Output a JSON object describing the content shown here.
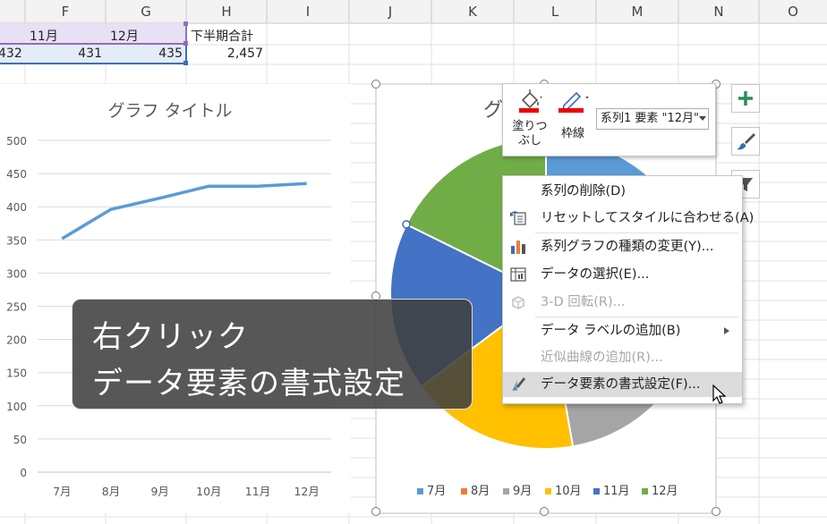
{
  "columns": [
    "F",
    "G",
    "H",
    "I",
    "J",
    "K",
    "L",
    "M",
    "N",
    "O"
  ],
  "sheet": {
    "header_row": {
      "f": "11月",
      "g": "12月",
      "h": "下半期合計"
    },
    "data_row": {
      "e_partial": "432",
      "f": "431",
      "g": "435",
      "h": "2,457"
    }
  },
  "line_chart": {
    "chart_data": {
      "type": "line",
      "title": "グラフ タイトル",
      "categories": [
        "7月",
        "8月",
        "9月",
        "10月",
        "11月",
        "12月"
      ],
      "values": [
        352,
        396,
        413,
        431,
        431,
        435
      ],
      "y_ticks": [
        "0",
        "50",
        "100",
        "150",
        "200",
        "250",
        "300",
        "350",
        "400",
        "450",
        "500"
      ],
      "ylim": [
        0,
        500
      ],
      "grid": true,
      "color": "#5b9bd5"
    }
  },
  "pie_chart": {
    "title_partial": "グ",
    "chart_data": {
      "type": "pie",
      "categories": [
        "7月",
        "8月",
        "9月",
        "10月",
        "11月",
        "12月"
      ],
      "values": [
        352,
        396,
        413,
        431,
        431,
        435
      ],
      "colors": [
        "#5b9bd5",
        "#ed7d31",
        "#a5a5a5",
        "#ffc000",
        "#4472c4",
        "#70ad47"
      ]
    },
    "legend": [
      "7月",
      "8月",
      "9月",
      "10月",
      "11月",
      "12月"
    ]
  },
  "mini_toolbar": {
    "fill_label_1": "塗りつ",
    "fill_label_2": "ぶし",
    "outline_label": "枠線",
    "series_dropdown": "系列1 要素 \"12月\"",
    "fill_icon": "paint-bucket-icon",
    "outline_icon": "pen-icon"
  },
  "side_buttons": {
    "plus_icon": "plus-icon",
    "style_icon": "brush-icon",
    "filter_icon": "filter-icon"
  },
  "context_menu": {
    "items": [
      {
        "label": "系列の削除(D)",
        "icon": "",
        "disabled": false
      },
      {
        "label": "リセットしてスタイルに合わせる(A)",
        "icon": "reset-style-icon",
        "disabled": false
      },
      {
        "label": "系列グラフの種類の変更(Y)...",
        "icon": "chart-type-icon",
        "disabled": false
      },
      {
        "label": "データの選択(E)...",
        "icon": "select-data-icon",
        "disabled": false
      },
      {
        "label": "3-D 回転(R)...",
        "icon": "3d-rotation-icon",
        "disabled": true
      },
      {
        "label": "データ ラベルの追加(B)",
        "icon": "",
        "disabled": false,
        "submenu": true
      },
      {
        "label": "近似曲線の追加(R)...",
        "icon": "",
        "disabled": true
      },
      {
        "label": "データ要素の書式設定(F)...",
        "icon": "format-point-icon",
        "disabled": false,
        "hover": true
      }
    ]
  },
  "caption": {
    "line1": "右クリック",
    "line2": "データ要素の書式設定"
  }
}
